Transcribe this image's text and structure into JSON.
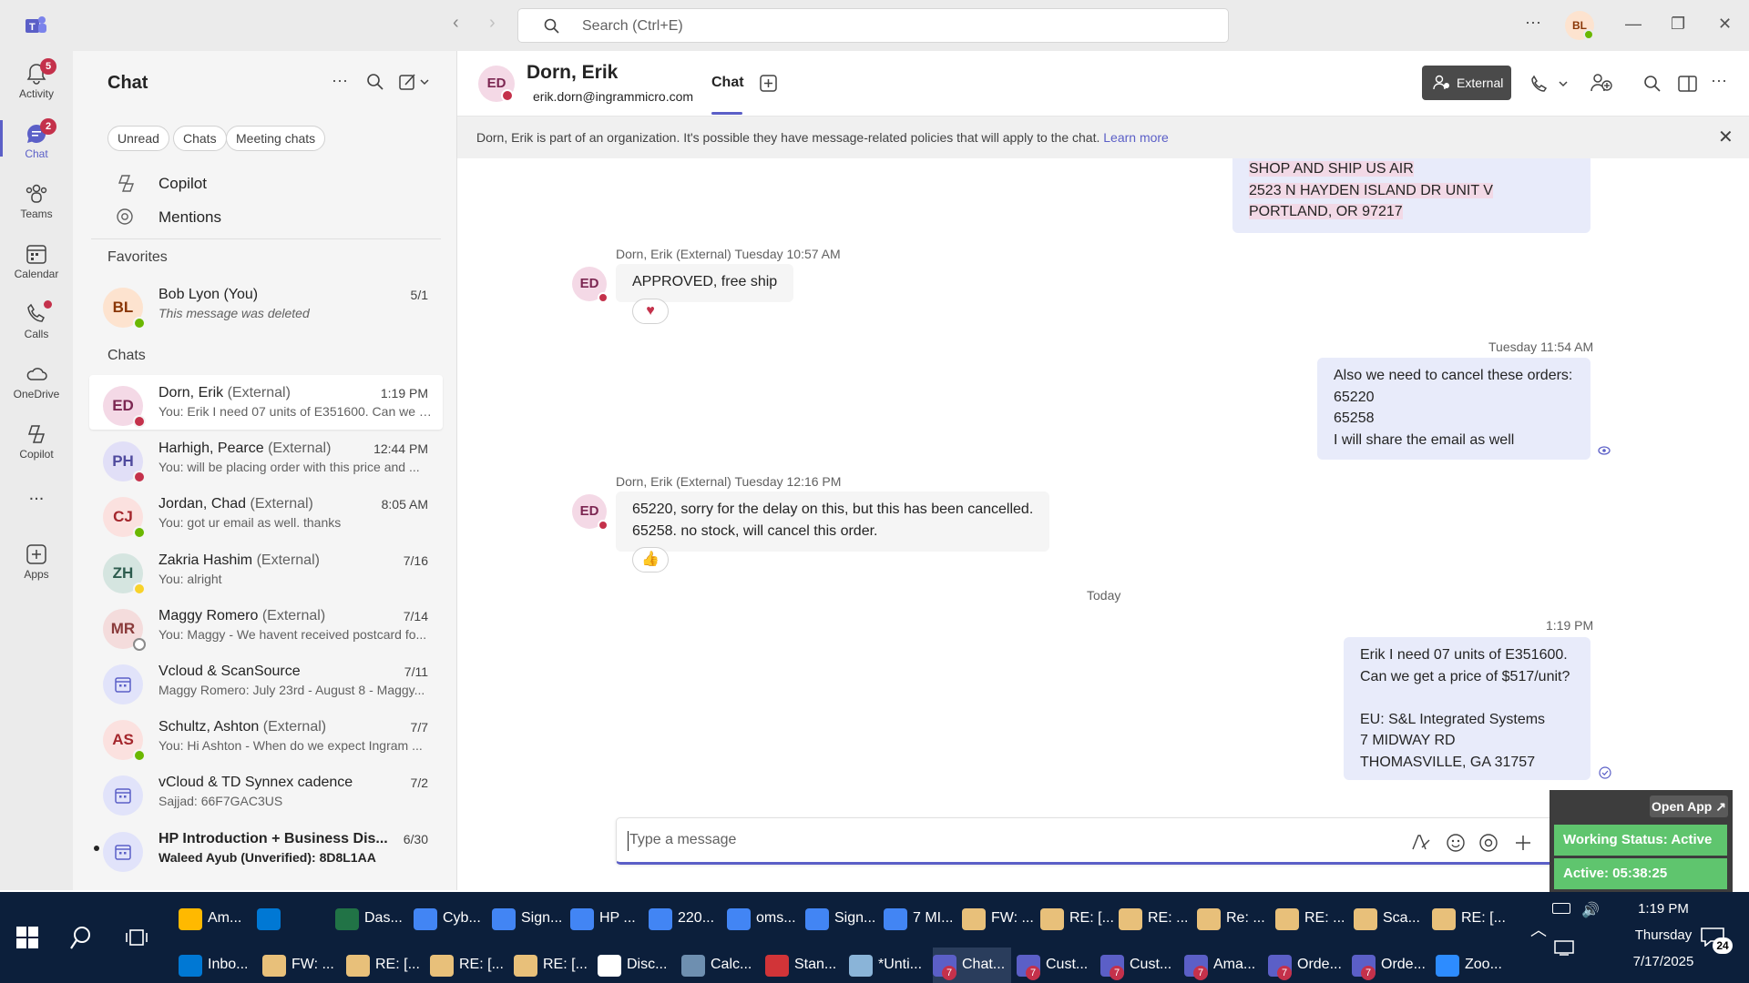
{
  "titlebar": {
    "search_placeholder": "Search (Ctrl+E)",
    "user_initials": "BL",
    "more": "···"
  },
  "rail": {
    "items": [
      {
        "label": "Activity",
        "badge": "5"
      },
      {
        "label": "Chat",
        "badge": "2"
      },
      {
        "label": "Teams"
      },
      {
        "label": "Calendar"
      },
      {
        "label": "Calls"
      },
      {
        "label": "OneDrive"
      },
      {
        "label": "Copilot"
      },
      {
        "label": "..."
      },
      {
        "label": "Apps"
      }
    ]
  },
  "chatlist": {
    "title": "Chat",
    "filters": [
      "Unread",
      "Chats",
      "Meeting chats"
    ],
    "nav": [
      "Copilot",
      "Mentions"
    ],
    "favorites_label": "Favorites",
    "chats_label": "Chats",
    "favorites": [
      {
        "initials": "BL",
        "name": "Bob Lyon (You)",
        "preview": "This message was deleted",
        "time": "5/1",
        "presence": "#6bb700",
        "av_bg": "#fde3cf",
        "av_fg": "#8a3707"
      }
    ],
    "chats": [
      {
        "initials": "ED",
        "name": "Dorn, Erik",
        "ext": "(External)",
        "preview": "You: Erik I need 07 units of E351600. Can we g...",
        "time": "1:19 PM",
        "presence": "#c4314b",
        "av_bg": "#f4d9e6",
        "av_fg": "#7c2752"
      },
      {
        "initials": "PH",
        "name": "Harhigh, Pearce",
        "ext": "(External)",
        "preview": "You: will be placing order with this price and ...",
        "time": "12:44 PM",
        "presence": "#c4314b",
        "av_bg": "#e1dff7",
        "av_fg": "#4f4a9e"
      },
      {
        "initials": "CJ",
        "name": "Jordan, Chad",
        "ext": "(External)",
        "preview": "You: got ur email as well. thanks",
        "time": "8:05 AM",
        "presence": "#6bb700",
        "av_bg": "#fbe1df",
        "av_fg": "#a4262c"
      },
      {
        "initials": "ZH",
        "name": "Zakria Hashim",
        "ext": "(External)",
        "preview": "You: alright",
        "time": "7/16",
        "presence": "#f8d22a",
        "av_bg": "#d5e5e0",
        "av_fg": "#2d5c4e"
      },
      {
        "initials": "MR",
        "name": "Maggy Romero",
        "ext": "(External)",
        "preview": "You: Maggy - We havent received postcard fo...",
        "time": "7/14",
        "presence": "#ffffff",
        "av_bg": "#f4dcdc",
        "av_fg": "#8a3a3a"
      },
      {
        "initials": "",
        "name": "Vcloud & ScanSource",
        "ext": "",
        "preview": "Maggy Romero: July 23rd - August 8 - Maggy...",
        "time": "7/11",
        "presence": "",
        "av_bg": "#e1e3fa",
        "av_fg": "#5b5fc7"
      },
      {
        "initials": "AS",
        "name": "Schultz, Ashton",
        "ext": "(External)",
        "preview": "You: Hi Ashton -  When do we expect Ingram ...",
        "time": "7/7",
        "presence": "#6bb700",
        "av_bg": "#fbe1df",
        "av_fg": "#a4262c"
      },
      {
        "initials": "",
        "name": "vCloud & TD Synnex cadence",
        "ext": "",
        "preview": "Sajjad: 66F7GAC3US",
        "time": "7/2",
        "presence": "",
        "av_bg": "#e1e3fa",
        "av_fg": "#5b5fc7"
      },
      {
        "initials": "",
        "name": "HP Introduction + Business Dis...",
        "ext": "",
        "preview": "Waleed Ayub (Unverified): 8D8L1AA",
        "time": "6/30",
        "presence": "",
        "av_bg": "#e1e3fa",
        "av_fg": "#5b5fc7",
        "unread": true
      }
    ]
  },
  "header": {
    "initials": "ED",
    "name": "Dorn, Erik",
    "email": "erik.dorn@ingrammicro.com",
    "tab": "Chat",
    "external": "External"
  },
  "banner": {
    "text": "Dorn, Erik is part of an organization. It's possible they have message-related policies that will apply to the chat.",
    "link": "Learn more"
  },
  "messages": {
    "addr_top": [
      "SHOP AND SHIP US AIR",
      "2523 N HAYDEN ISLAND DR UNIT V",
      "PORTLAND, OR 97217"
    ],
    "m1_meta": "Dorn, Erik (External)  Tuesday 10:57 AM",
    "m1_text": "APPROVED, free ship",
    "m1_reaction": "♥",
    "m2_time": "Tuesday 11:54 AM",
    "m2_lines": [
      "Also we need to cancel these orders:",
      "65220",
      "65258",
      "I will share the email as well"
    ],
    "m3_meta": "Dorn, Erik (External)  Tuesday 12:16 PM",
    "m3_lines": [
      "65220, sorry for the delay on this, but this has been cancelled.",
      "65258. no stock, will cancel this order."
    ],
    "m3_reaction": "👍",
    "divider": "Today",
    "m4_time": "1:19 PM",
    "m4_lines": [
      "Erik I need 07 units of E351600.",
      "Can we get a price of $517/unit?",
      "",
      "EU: S&L Integrated Systems",
      "7 MIDWAY RD",
      "THOMASVILLE, GA 31757"
    ]
  },
  "compose": {
    "placeholder": "Type a message"
  },
  "widget": {
    "open_app": "Open App ↗",
    "status": "Working Status: Active",
    "active": "Active: 05:38:25"
  },
  "taskbar": {
    "row1": [
      "Am...",
      "",
      "Das...",
      "Cyb...",
      "Sign...",
      "HP ...",
      "220...",
      "oms...",
      "Sign...",
      "7 MI...",
      "FW: ...",
      "RE: [...",
      "RE: ...",
      "Re: ...",
      "RE: ...",
      "Sca...",
      "RE: [..."
    ],
    "row2": [
      "Inbo...",
      "FW: ...",
      "RE: [...",
      "RE: [...",
      "RE: [...",
      "Disc...",
      "Calc...",
      "Stan...",
      "*Unti...",
      "Chat...",
      "Cust...",
      "Cust...",
      "Ama...",
      "Orde...",
      "Orde...",
      "Zoo..."
    ],
    "time": "1:19 PM",
    "day": "Thursday",
    "date": "7/17/2025",
    "notif_count": "24"
  }
}
